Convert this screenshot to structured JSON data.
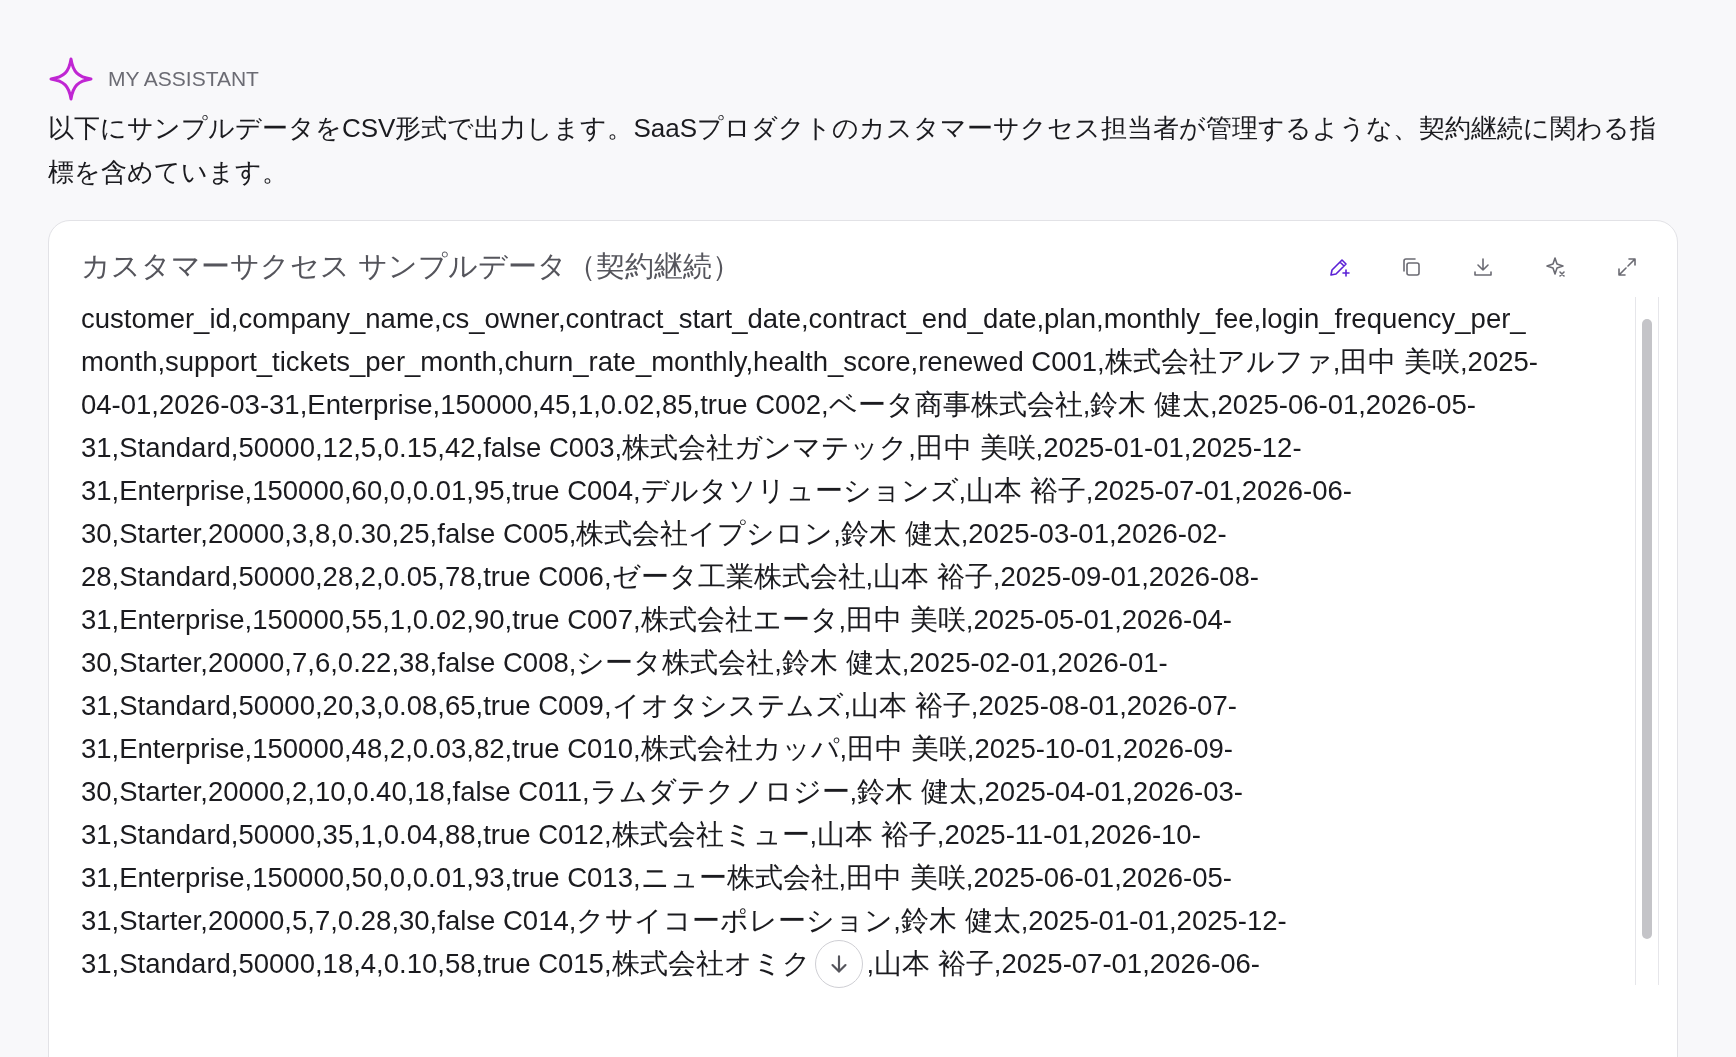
{
  "assistant": {
    "name": "MY ASSISTANT",
    "message": "以下にサンプルデータをCSV形式で出力します。SaaSプロダクトのカスタマーサクセス担当者が管理するような、契約継続に関わる指標を含めています。"
  },
  "artifact": {
    "title": "カスタマーサクセス サンプルデータ（契約継続）",
    "toolbar": [
      {
        "kind": "edit",
        "selected": true
      },
      {
        "kind": "copy",
        "selected": false
      },
      {
        "kind": "download",
        "selected": false
      },
      {
        "kind": "share",
        "selected": false
      },
      {
        "kind": "expand",
        "selected": false
      }
    ],
    "lines": [
      [
        "customer_id,company_name,cs_owner,contract_start_date,contract_end_date,plan,monthly_fee,login_frequency_per_"
      ],
      [
        "month,support_tickets_per_month,churn_rate_monthly,health_score,renewed C001,株式会社アルファ,田中 美咲,2025-"
      ],
      [
        "04-01,2026-03-31,Enterprise,150000,45,1,0.02,85,true C002,ベータ商事株式会社,鈴木 健太,2025-06-01,2026-05-"
      ],
      [
        "31,Standard,50000,12,5,0.15,42,false C003,株式会社ガンマテック,田中 美咲,2025-01-01,2025-12-"
      ],
      [
        "31,Enterprise,150000,60,0,0.01,95,true C004,デルタソリューションズ,山本 裕子,2025-07-01,2026-06-"
      ],
      [
        "30,Starter,20000,3,8,0.30,25,false C005,株式会社イプシロン,鈴木 健太,2025-03-01,2026-02-"
      ],
      [
        "28,Standard,50000,28,2,0.05,78,true C006,ゼータ工業株式会社,山本 裕子,2025-09-01,2026-08-"
      ],
      [
        "31,Enterprise,150000,55,1,0.02,90,true C007,株式会社エータ,田中 美咲,2025-05-01,2026-04-"
      ],
      [
        "30,Starter,20000,7,6,0.22,38,false C008,シータ株式会社,鈴木 健太,2025-02-01,2026-01-"
      ],
      [
        "31,Standard,50000,20,3,0.08,65,true C009,イオタシステムズ,山本 裕子,2025-08-01,2026-07-"
      ],
      [
        "31,Enterprise,150000,48,2,0.03,82,true C010,株式会社カッパ,田中 美咲,2025-10-01,2026-09-"
      ],
      [
        "30,Starter,20000,2,10,0.40,18,false C011,ラムダテクノロジー,鈴木 健太,2025-04-01,2026-03-"
      ],
      [
        "31,Standard,50000,35,1,0.04,88,true C012,株式会社ミュー,山本 裕子,2025-11-01,2026-10-"
      ],
      [
        "31,Enterprise,150000,50,0,0.01,93,true C013,ニュー株式会社,田中 美咲,2025-06-01,2026-05-"
      ],
      [
        "31,Starter,20000,5,7,0.28,30,false C014,クサイコーポレーション,鈴木 健太,2025-01-01,2025-12-"
      ],
      [
        "31,Standard,50000,18,4,0.10,58,true C015,株式会社オミク",
        ",山本 裕子,2025-07-01,2026-06-"
      ]
    ]
  }
}
